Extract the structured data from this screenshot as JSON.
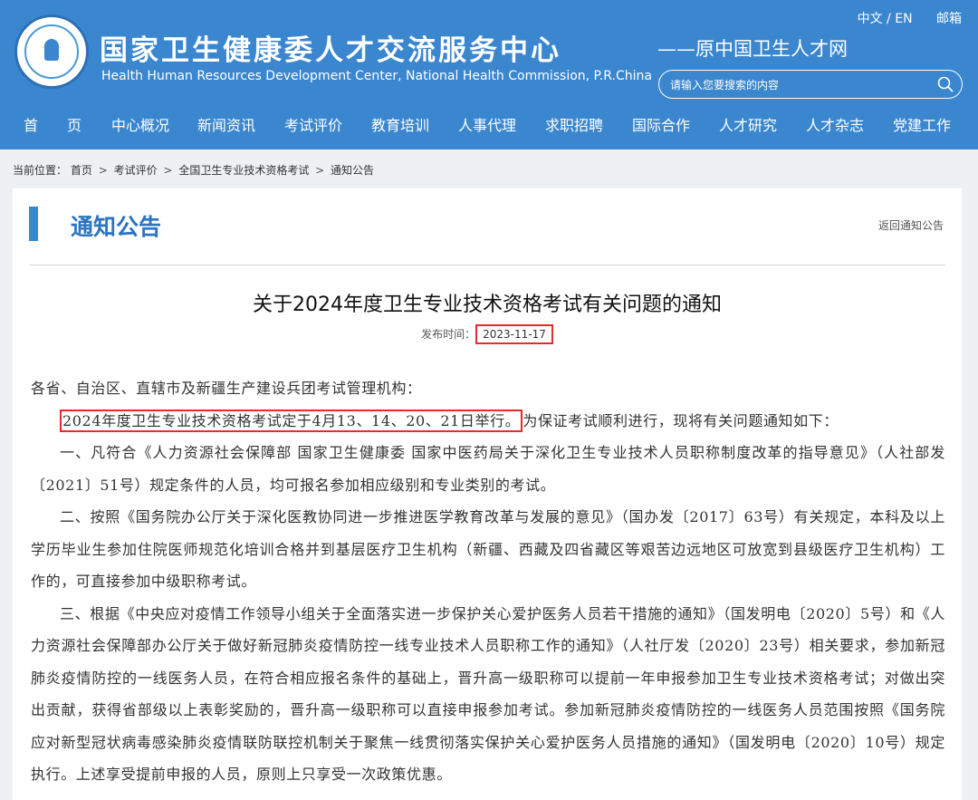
{
  "header": {
    "site_name": "国家卫生健康委人才交流服务中心",
    "site_name_en": "Health Human Resources Development Center, National Health Commission, P.R.China",
    "former_name": "——原中国卫生人才网",
    "lang_switch": "中文 / EN",
    "mailbox": "邮箱",
    "search_placeholder": "请输入您要搜索的内容",
    "logo_icon": "emblem-logo"
  },
  "nav": {
    "items": [
      "首　　页",
      "中心概况",
      "新闻资讯",
      "考试评价",
      "教育培训",
      "人事代理",
      "求职招聘",
      "国际合作",
      "人才研究",
      "人才杂志",
      "党建工作"
    ]
  },
  "breadcrumb": {
    "label": "当前位置：",
    "items": [
      "首页",
      "考试评价",
      "全国卫生专业技术资格考试",
      "通知公告"
    ],
    "separator": ">"
  },
  "section": {
    "title": "通知公告",
    "back_link": "返回通知公告"
  },
  "article": {
    "title": "关于2024年度卫生专业技术资格考试有关问题的通知",
    "publish_label": "发布时间：",
    "publish_date": "2023-11-17",
    "greeting": "各省、自治区、直辖市及新疆生产建设兵团考试管理机构：",
    "highlight": "2024年度卫生专业技术资格考试定于4月13、14、20、21日举行。",
    "intro_rest": "为保证考试顺利进行，现将有关问题通知如下：",
    "para1": "一、凡符合《人力资源社会保障部 国家卫生健康委 国家中医药局关于深化卫生专业技术人员职称制度改革的指导意见》（人社部发〔2021〕51号）规定条件的人员，均可报名参加相应级别和专业类别的考试。",
    "para2": "二、按照《国务院办公厅关于深化医教协同进一步推进医学教育改革与发展的意见》（国办发〔2017〕63号）有关规定，本科及以上学历毕业生参加住院医师规范化培训合格并到基层医疗卫生机构（新疆、西藏及四省藏区等艰苦边远地区可放宽到县级医疗卫生机构）工作的，可直接参加中级职称考试。",
    "para3": "三、根据《中央应对疫情工作领导小组关于全面落实进一步保护关心爱护医务人员若干措施的通知》（国发明电〔2020〕5号）和《人力资源社会保障部办公厅关于做好新冠肺炎疫情防控一线专业技术人员职称工作的通知》（人社厅发〔2020〕23号）相关要求，参加新冠肺炎疫情防控的一线医务人员，在符合相应报名条件的基础上，晋升高一级职称可以提前一年申报参加卫生专业技术资格考试；对做出突出贡献，获得省部级以上表彰奖励的，晋升高一级职称可以直接申报参加考试。参加新冠肺炎疫情防控的一线医务人员范围按照《国务院应对新型冠状病毒感染肺炎疫情联防联控机制关于聚焦一线贯彻落实保护关心爱护医务人员措施的通知》（国发明电〔2020〕10号）规定执行。上述享受提前申报的人员，原则上只享受一次政策优惠。"
  },
  "colors": {
    "header_blue": "#3a86cf",
    "title_blue": "#2b74c0",
    "highlight_red": "#e52b2b"
  }
}
